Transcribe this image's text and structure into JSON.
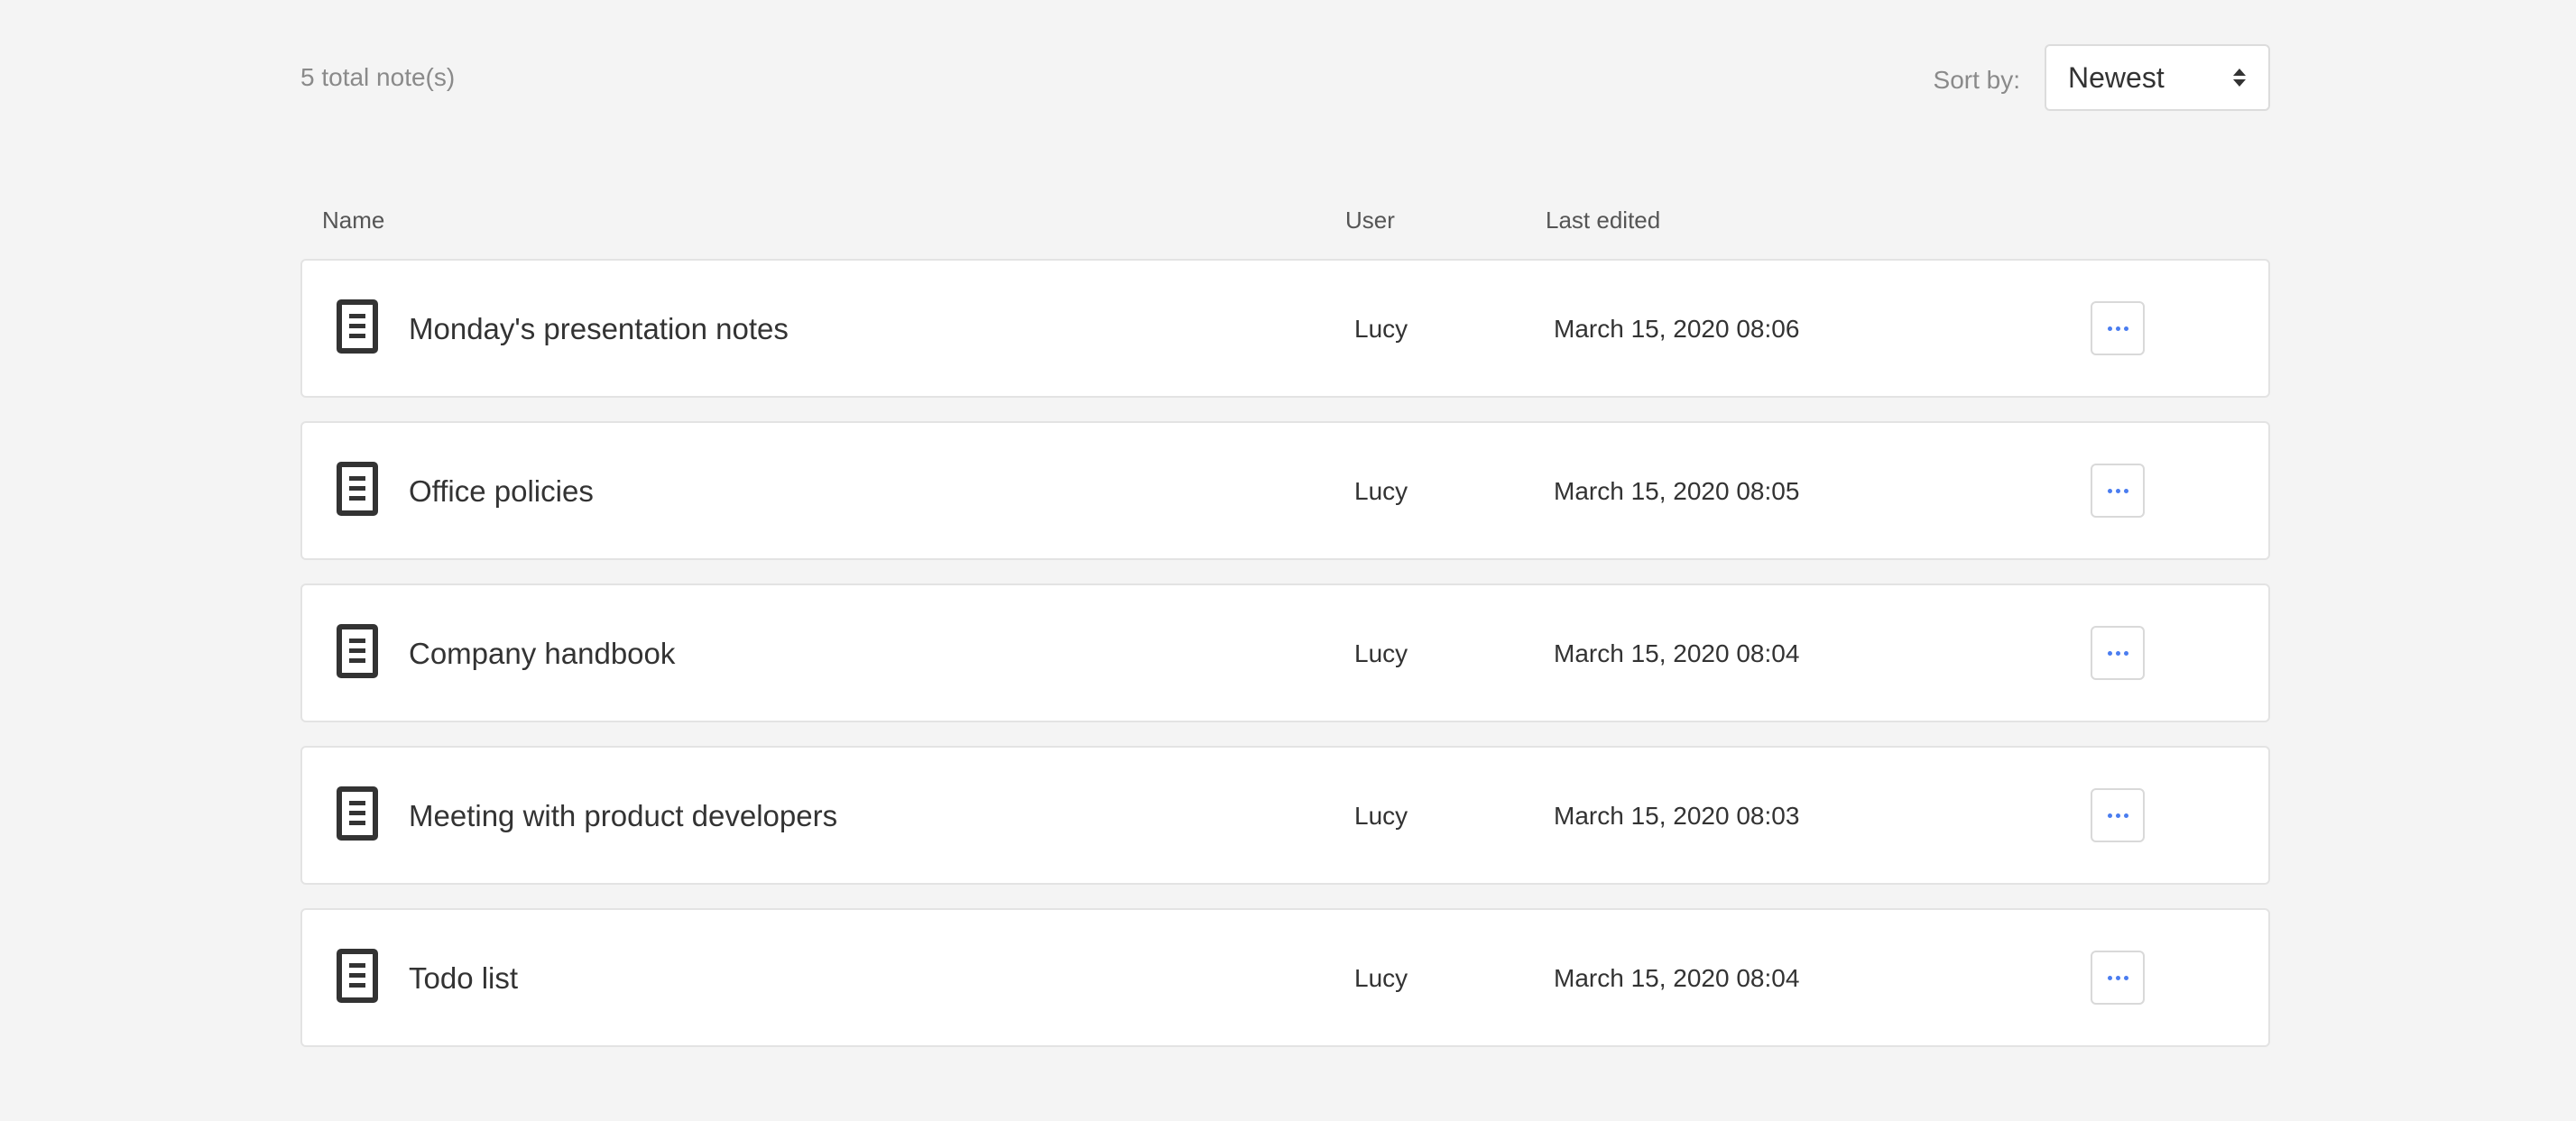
{
  "summary": {
    "total_label": "5 total note(s)"
  },
  "sort": {
    "label": "Sort by:",
    "selected": "Newest"
  },
  "columns": {
    "name": "Name",
    "user": "User",
    "last_edited": "Last edited"
  },
  "notes": [
    {
      "name": "Monday's presentation notes",
      "user": "Lucy",
      "last_edited": "March 15, 2020 08:06",
      "icon": "document-icon"
    },
    {
      "name": "Office policies",
      "user": "Lucy",
      "last_edited": "March 15, 2020 08:05",
      "icon": "document-icon"
    },
    {
      "name": "Company handbook",
      "user": "Lucy",
      "last_edited": "March 15, 2020 08:04",
      "icon": "document-icon"
    },
    {
      "name": "Meeting with product developers",
      "user": "Lucy",
      "last_edited": "March 15, 2020 08:03",
      "icon": "document-icon"
    },
    {
      "name": "Todo list",
      "user": "Lucy",
      "last_edited": "March 15, 2020 08:04",
      "icon": "document-icon"
    }
  ],
  "colors": {
    "background": "#f4f4f4",
    "card": "#ffffff",
    "accent": "#4a7df0",
    "icon": "#333333"
  }
}
